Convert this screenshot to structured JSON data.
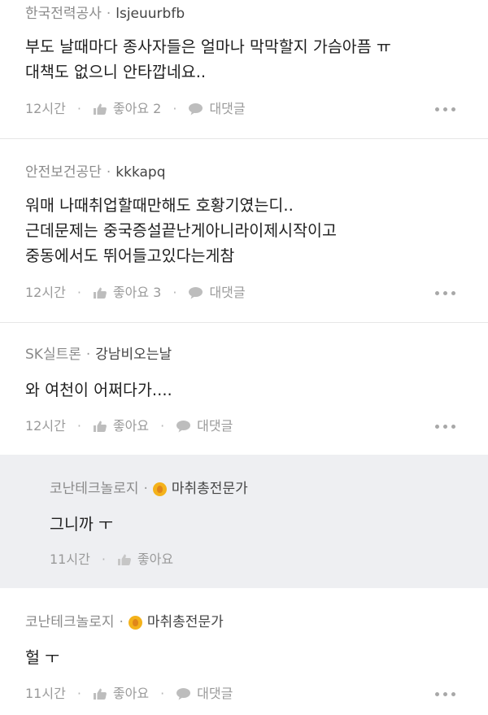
{
  "comments": [
    {
      "company": "한국전력공사",
      "nickname": "lsjeuurbfb",
      "body_lines": [
        "부도 날때마다 종사자들은 얼마나 막막할지 가슴아픔 ㅠ",
        "대책도 없으니 안타깝네요.."
      ],
      "time": "12시간",
      "like_label": "좋아요 2",
      "reply_label": "대댓글"
    },
    {
      "company": "안전보건공단",
      "nickname": "kkkapq",
      "body_lines": [
        "워매 나때취업할때만해도 호황기였는디..",
        "근데문제는 중국증설끝난게아니라이제시작이고",
        "중동에서도 뛰어들고있다는게참"
      ],
      "time": "12시간",
      "like_label": "좋아요 3",
      "reply_label": "대댓글"
    },
    {
      "company": "SK실트론",
      "nickname": "강남비오는날",
      "body_lines": [
        "와 여천이 어쩌다가...."
      ],
      "time": "12시간",
      "like_label": "좋아요",
      "reply_label": "대댓글"
    },
    {
      "company": "코난테크놀로지",
      "nickname": "마취총전문가",
      "badge_icon": "gold-medal-icon",
      "body_lines": [
        "그니까 ㅜ"
      ],
      "time": "11시간",
      "like_label": "좋아요"
    },
    {
      "company": "코난테크놀로지",
      "nickname": "마취총전문가",
      "badge_icon": "gold-medal-icon",
      "body_lines": [
        "헐 ㅜ"
      ],
      "time": "11시간",
      "like_label": "좋아요",
      "reply_label": "대댓글"
    }
  ],
  "icons": {
    "like": "thumbs-up-icon",
    "reply": "speech-bubble-icon",
    "more": "more-options-icon"
  },
  "colors": {
    "reply_background": "#eeeff2",
    "badge": "#f4b21b",
    "meta_text": "#9a9a9a"
  }
}
